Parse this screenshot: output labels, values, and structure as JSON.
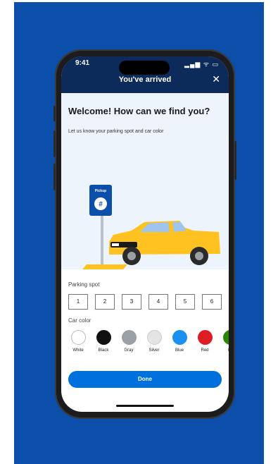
{
  "status_bar": {
    "time": "9:41",
    "icons": "▂▄▆ ᯤ ▭"
  },
  "header": {
    "title": "You've arrived",
    "close_glyph": "✕"
  },
  "hero": {
    "headline": "Welcome! How can we find you?",
    "subtitle": "Let us know your parking spot and car color",
    "sign_label": "Pickup",
    "sign_symbol": "#"
  },
  "parking": {
    "label": "Parking spot",
    "spots": [
      "1",
      "2",
      "3",
      "4",
      "5",
      "6"
    ]
  },
  "car_color": {
    "label": "Car color",
    "options": [
      {
        "name": "White",
        "color": "#ffffff"
      },
      {
        "name": "Black",
        "color": "#111111"
      },
      {
        "name": "Gray",
        "color": "#9aa0a6"
      },
      {
        "name": "Silver",
        "color": "#e2e4e6"
      },
      {
        "name": "Blue",
        "color": "#1a91f0"
      },
      {
        "name": "Red",
        "color": "#de1c24"
      },
      {
        "name": "Gr",
        "color": "#2a8703"
      }
    ]
  },
  "done_label": "Done",
  "colors": {
    "brand_blue": "#0b4fab",
    "header_navy": "#0c2a5a",
    "car_yellow": "#ffc220",
    "button_blue": "#0071dc"
  }
}
